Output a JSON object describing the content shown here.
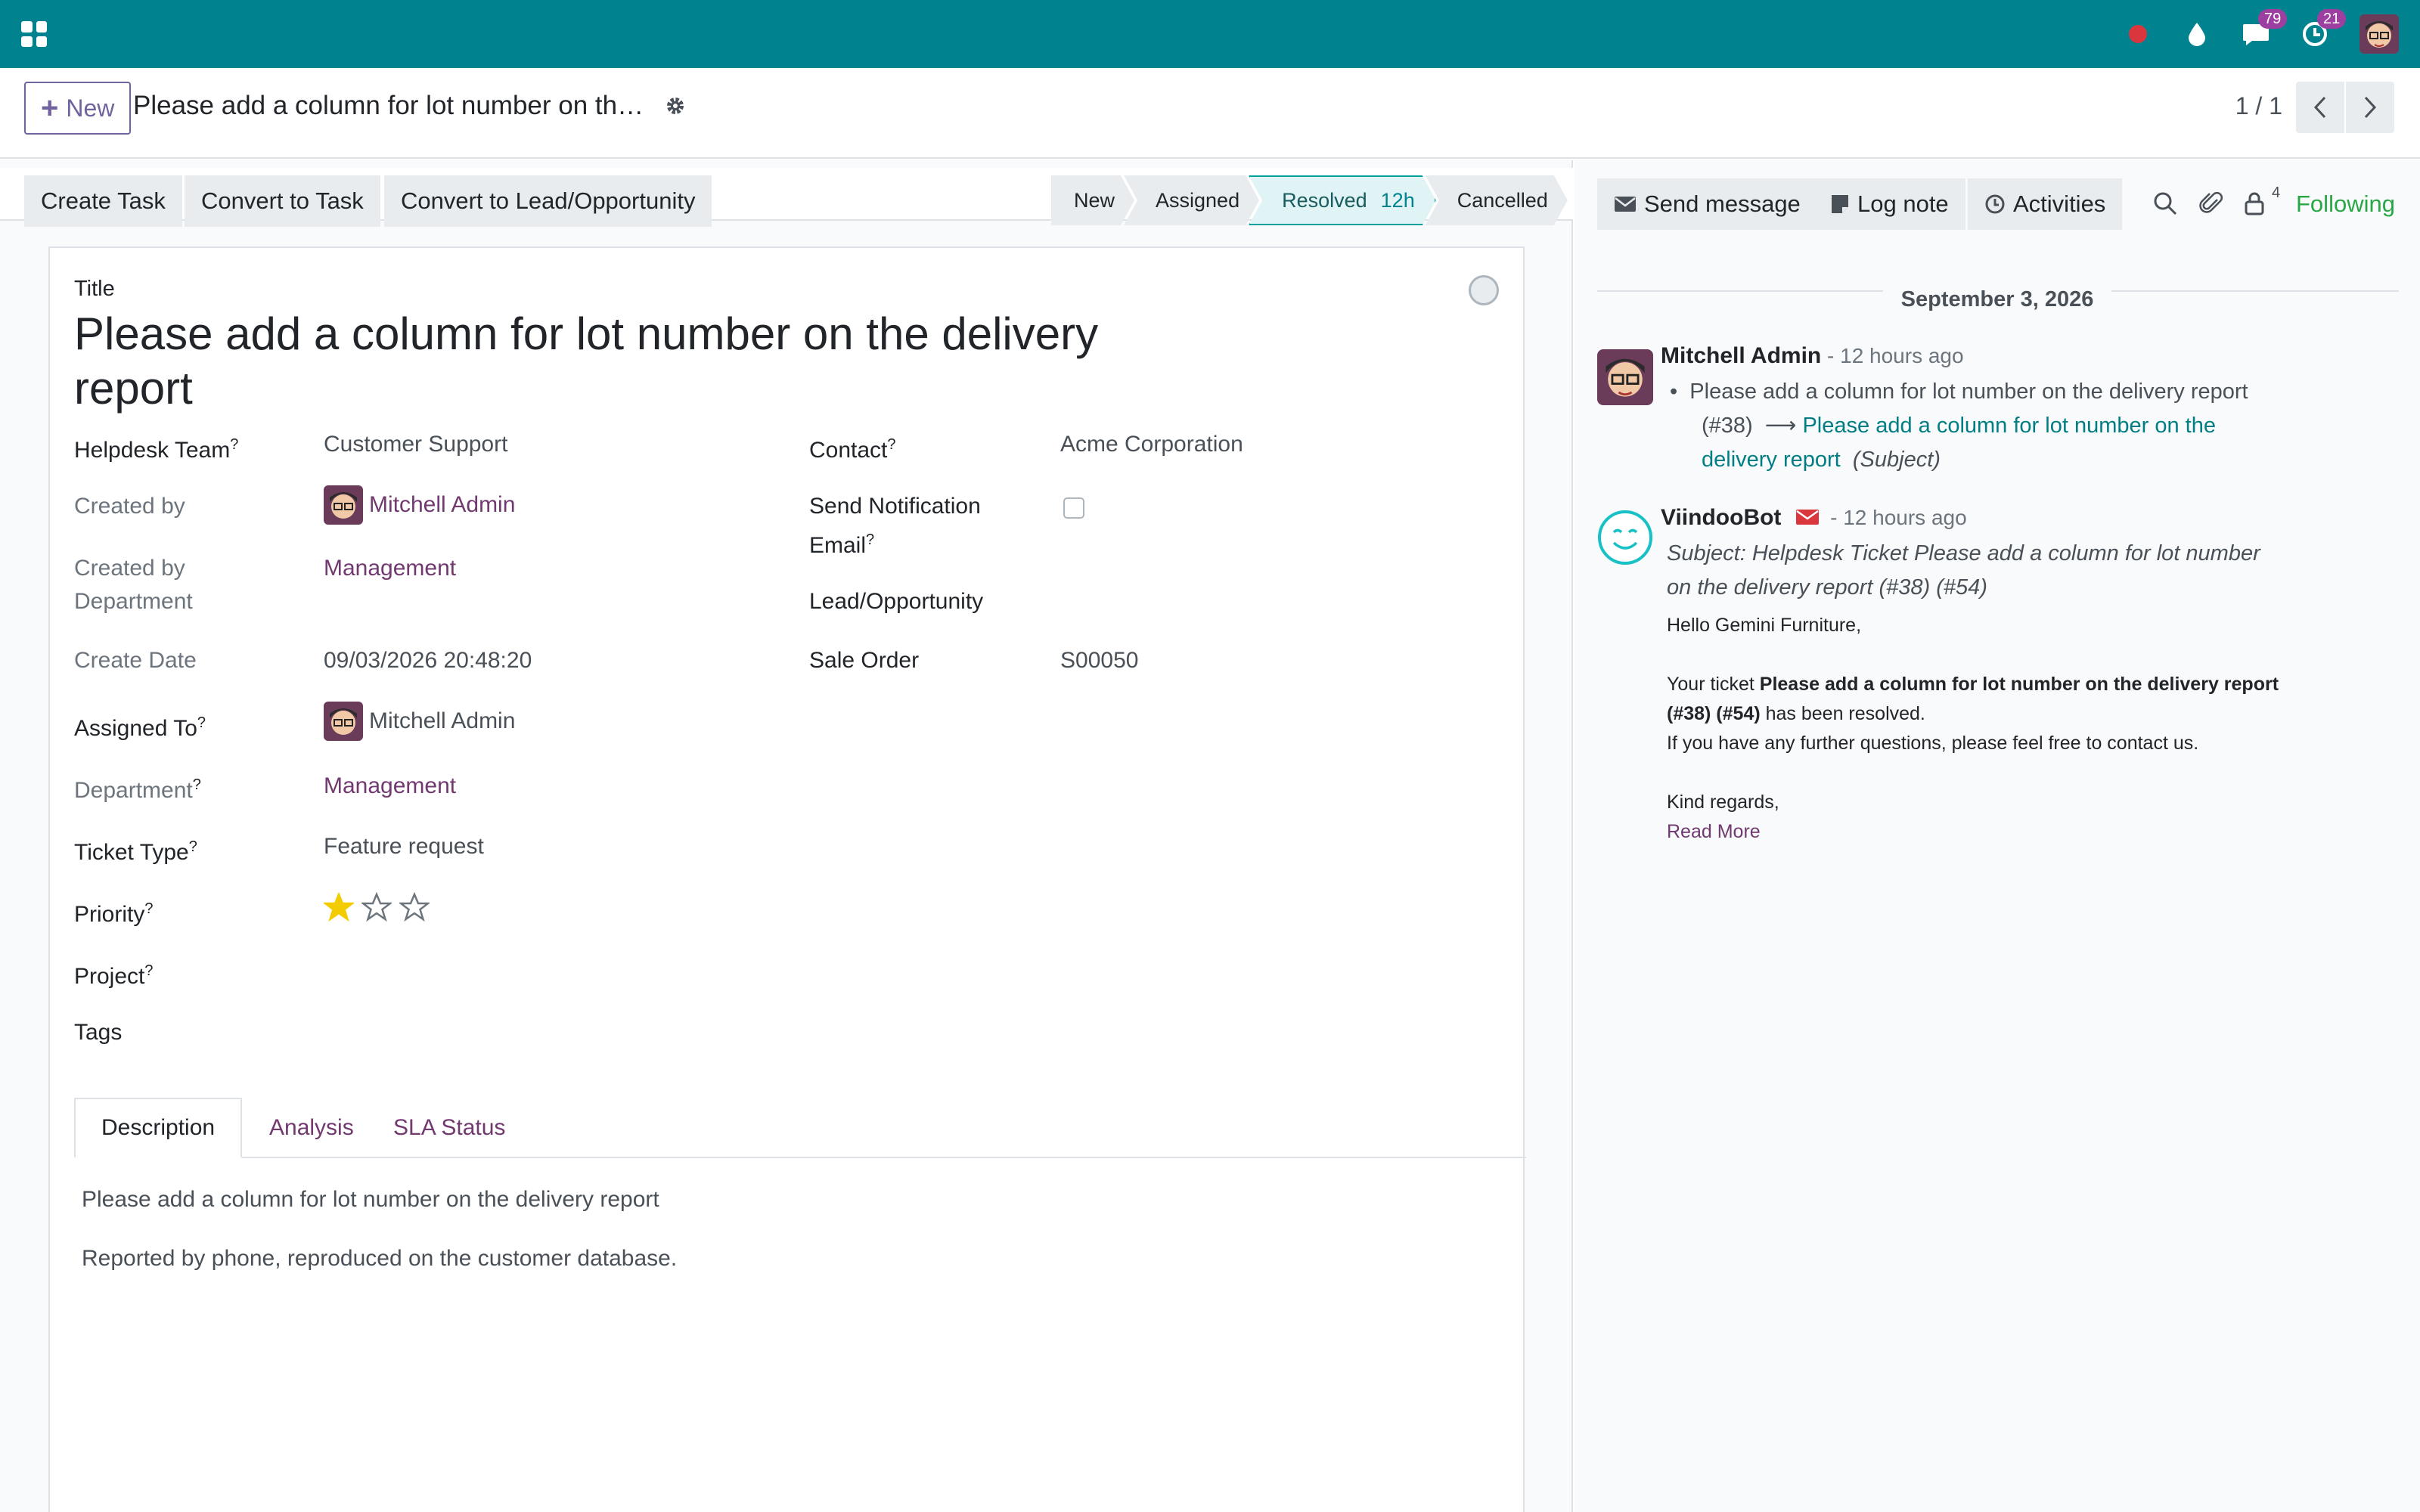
{
  "navbar": {
    "chat_count": "79",
    "activity_count": "21"
  },
  "control_panel": {
    "new_label": "New",
    "breadcrumb": "Please add a column for lot number on th…",
    "pager": "1 / 1"
  },
  "statusbar": {
    "actions": [
      "Create Task",
      "Convert to Task",
      "Convert to Lead/Opportunity"
    ],
    "stages": {
      "new": "New",
      "assigned": "Assigned",
      "resolved": "Resolved",
      "resolved_duration": "12h",
      "cancelled": "Cancelled"
    }
  },
  "form": {
    "title_label": "Title",
    "title": "Please add a column for lot number on the delivery report",
    "left": {
      "helpdesk_team_label": "Helpdesk Team",
      "helpdesk_team": "Customer Support",
      "created_by_label": "Created by",
      "created_by": "Mitchell Admin",
      "created_by_dept_label_1": "Created by",
      "created_by_dept_label_2": "Department",
      "created_by_dept": "Management",
      "create_date_label": "Create Date",
      "create_date": "09/03/2026 20:48:20",
      "assigned_to_label": "Assigned To",
      "assigned_to": "Mitchell Admin",
      "department_label": "Department",
      "department": "Management",
      "ticket_type_label": "Ticket Type",
      "ticket_type": "Feature request",
      "priority_label": "Priority",
      "priority_value": 1,
      "priority_max": 3,
      "project_label": "Project",
      "tags_label": "Tags"
    },
    "right": {
      "contact_label": "Contact",
      "contact": "Acme Corporation",
      "send_notif_label_1": "Send Notification",
      "send_notif_label_2": "Email",
      "lead_label": "Lead/Opportunity",
      "sale_order_label": "Sale Order",
      "sale_order": "S00050"
    },
    "tooltip_mark": "?",
    "tabs": [
      "Description",
      "Analysis",
      "SLA Status"
    ],
    "description": [
      "Please add a column for lot number on the delivery report",
      "Reported by phone, reproduced on the customer database."
    ]
  },
  "chatter": {
    "send_message": "Send message",
    "log_note": "Log note",
    "activities": "Activities",
    "follower_count": "4",
    "following": "Following",
    "date": "September 3, 2026",
    "messages": [
      {
        "author": "Mitchell Admin",
        "time": " - 12 hours ago",
        "change_old": "Please add a column for lot number on the delivery report",
        "change_old_2": "(#38)",
        "change_new_1": "Please add a column for lot number on the",
        "change_new_2": "delivery report",
        "change_field": "(Subject)"
      },
      {
        "author": "ViindooBot",
        "time": " - 12 hours ago",
        "subject_1": "Subject: Helpdesk Ticket Please add a column for lot number",
        "subject_2": "on the delivery report (#38) (#54)",
        "greeting": "Hello Gemini Furniture,",
        "body_prefix": "Your ticket ",
        "body_bold_1": "Please add a column for lot number on the delivery report",
        "body_bold_2": "(#38) (#54)",
        "body_suffix": " has been resolved.",
        "body_line_3": "If you have any further questions, please feel free to contact us.",
        "regards": "Kind regards,",
        "read_more": "Read More"
      }
    ]
  },
  "colors": {
    "navbar": "#00838f",
    "primary": "#71639e",
    "link": "#71396f",
    "chatter_link": "#017e84",
    "following": "#28a745",
    "star": "#f3cc00"
  }
}
